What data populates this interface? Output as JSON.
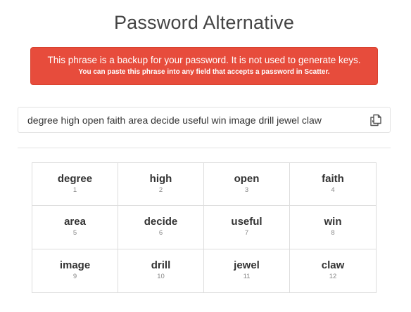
{
  "page": {
    "title": "Password Alternative"
  },
  "alert": {
    "main": "This phrase is a backup for your password. It is not used to generate keys.",
    "sub": "You can paste this phrase into any field that accepts a password in Scatter.",
    "color": "#e74c3c"
  },
  "phrase": {
    "text": "degree high open faith area decide useful win image drill jewel claw",
    "copy_icon": "copy-icon"
  },
  "words": [
    {
      "word": "degree",
      "num": "1"
    },
    {
      "word": "high",
      "num": "2"
    },
    {
      "word": "open",
      "num": "3"
    },
    {
      "word": "faith",
      "num": "4"
    },
    {
      "word": "area",
      "num": "5"
    },
    {
      "word": "decide",
      "num": "6"
    },
    {
      "word": "useful",
      "num": "7"
    },
    {
      "word": "win",
      "num": "8"
    },
    {
      "word": "image",
      "num": "9"
    },
    {
      "word": "drill",
      "num": "10"
    },
    {
      "word": "jewel",
      "num": "11"
    },
    {
      "word": "claw",
      "num": "12"
    }
  ]
}
